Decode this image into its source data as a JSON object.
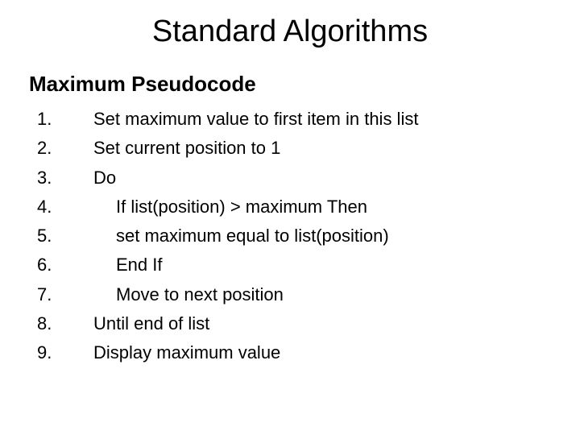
{
  "title": "Standard Algorithms",
  "subtitle": "Maximum Pseudocode",
  "lines": [
    {
      "n": "1.",
      "t": "Set maximum value to first item in this list",
      "indent": false
    },
    {
      "n": "2.",
      "t": "Set current position to 1",
      "indent": false
    },
    {
      "n": "3.",
      "t": "Do",
      "indent": false
    },
    {
      "n": "4.",
      "t": "If list(position) > maximum  Then",
      "indent": true
    },
    {
      "n": "5.",
      "t": "set maximum equal to list(position)",
      "indent": true
    },
    {
      "n": "6.",
      "t": "End If",
      "indent": true
    },
    {
      "n": "7.",
      "t": "Move to next position",
      "indent": true
    },
    {
      "n": "8.",
      "t": "Until end of list",
      "indent": false
    },
    {
      "n": "9.",
      "t": "Display maximum value",
      "indent": false
    }
  ]
}
